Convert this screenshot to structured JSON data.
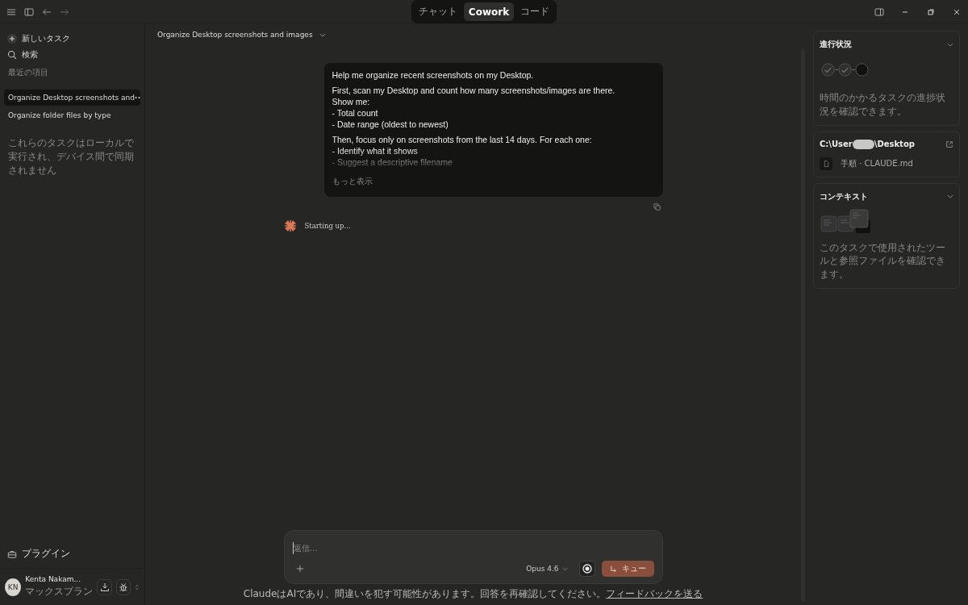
{
  "mode_tabs": [
    {
      "label": "チャット",
      "selected": false
    },
    {
      "label": "Cowork",
      "selected": true
    },
    {
      "label": "コード",
      "selected": false
    }
  ],
  "sidebar": {
    "new_task": "新しいタスク",
    "search": "検索",
    "recents_heading": "最近の項目",
    "items": [
      {
        "label": "Organize Desktop screenshots and",
        "selected": true
      },
      {
        "label": "Organize folder files by type",
        "selected": false
      }
    ],
    "note": "これらのタスクはローカルで実行され、デバイス間で同期されません",
    "plugins": "プラグイン",
    "user": {
      "initials": "KN",
      "name": "Kenta Nakam...",
      "plan": "マックスプラン"
    }
  },
  "conversation": {
    "title": "Organize Desktop screenshots and images",
    "message": {
      "collapsed": true,
      "show_more": "もっと表示",
      "paragraphs": [
        [
          "Help me organize recent screenshots on my Desktop."
        ],
        [
          "First, scan my Desktop and count how many screenshots/images are there.",
          "Show me:",
          "- Total count",
          "- Date range (oldest to newest)"
        ],
        [
          "Then, focus only on screenshots from the last 14 days. For each one:",
          "- Identify what it shows",
          "- Suggest a descriptive filename"
        ]
      ]
    },
    "status": "Starting up..."
  },
  "composer": {
    "placeholder": "返信…",
    "model": "Opus 4.6",
    "send_label": "キュー"
  },
  "disclaimer": "ClaudeはAIであり、間違いを犯す可能性があります。回答を再確認してください。",
  "feedback_link": "フィードバックを送る",
  "panel": {
    "progress": {
      "title": "進行状況",
      "steps": [
        {
          "done": true
        },
        {
          "done": true
        },
        {
          "done": false
        }
      ],
      "description": "時間のかかるタスクの進捗状況を確認できます。"
    },
    "folder": {
      "path_start": "C:\\User",
      "path_end": "\\Desktop",
      "files": [
        "手順 · CLAUDE.md"
      ]
    },
    "context": {
      "title": "コンテキスト",
      "description": "このタスクで使用されたツールと参照ファイルを確認できます。"
    }
  }
}
